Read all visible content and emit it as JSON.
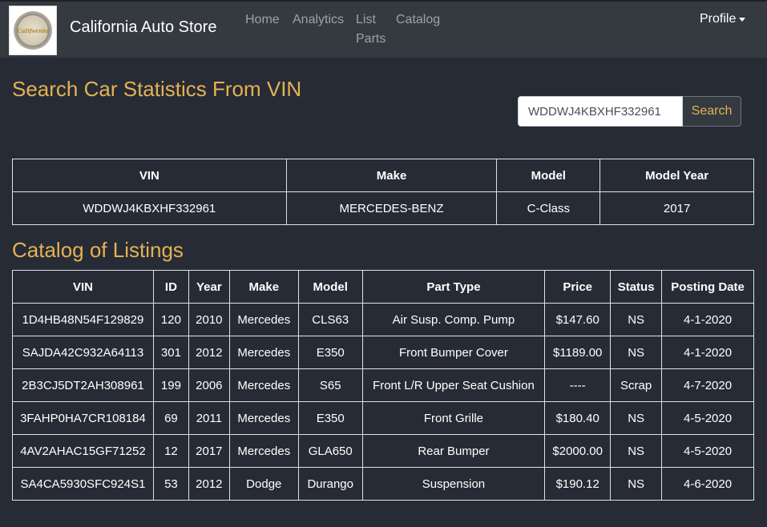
{
  "navbar": {
    "logo_text": "California",
    "brand": "California Auto Store",
    "links": [
      "Home",
      "Analytics",
      "List Parts",
      "Catalog"
    ],
    "profile": "Profile"
  },
  "search_section": {
    "title": "Search Car Statistics From VIN",
    "input_value": "WDDWJ4KBXHF332961",
    "button_label": "Search"
  },
  "vin_table": {
    "headers": [
      "VIN",
      "Make",
      "Model",
      "Model Year"
    ],
    "row": [
      "WDDWJ4KBXHF332961",
      "MERCEDES-BENZ",
      "C-Class",
      "2017"
    ]
  },
  "catalog_section": {
    "title": "Catalog of Listings"
  },
  "catalog_table": {
    "headers": [
      "VIN",
      "ID",
      "Year",
      "Make",
      "Model",
      "Part Type",
      "Price",
      "Status",
      "Posting Date"
    ],
    "rows": [
      [
        "1D4HB48N54F129829",
        "120",
        "2010",
        "Mercedes",
        "CLS63",
        "Air Susp. Comp. Pump",
        "$147.60",
        "NS",
        "4-1-2020"
      ],
      [
        "SAJDA42C932A64113",
        "301",
        "2012",
        "Mercedes",
        "E350",
        "Front Bumper Cover",
        "$1189.00",
        "NS",
        "4-1-2020"
      ],
      [
        "2B3CJ5DT2AH308961",
        "199",
        "2006",
        "Mercedes",
        "S65",
        "Front L/R Upper Seat Cushion",
        "----",
        "Scrap",
        "4-7-2020"
      ],
      [
        "3FAHP0HA7CR108184",
        "69",
        "2011",
        "Mercedes",
        "E350",
        "Front Grille",
        "$180.40",
        "NS",
        "4-5-2020"
      ],
      [
        "4AV2AHAC15GF71252",
        "12",
        "2017",
        "Mercedes",
        "GLA650",
        "Rear Bumper",
        "$2000.00",
        "NS",
        "4-5-2020"
      ],
      [
        "SA4CA5930SFC924S1",
        "53",
        "2012",
        "Dodge",
        "Durango",
        "Suspension",
        "$190.12",
        "NS",
        "4-6-2020"
      ]
    ]
  }
}
